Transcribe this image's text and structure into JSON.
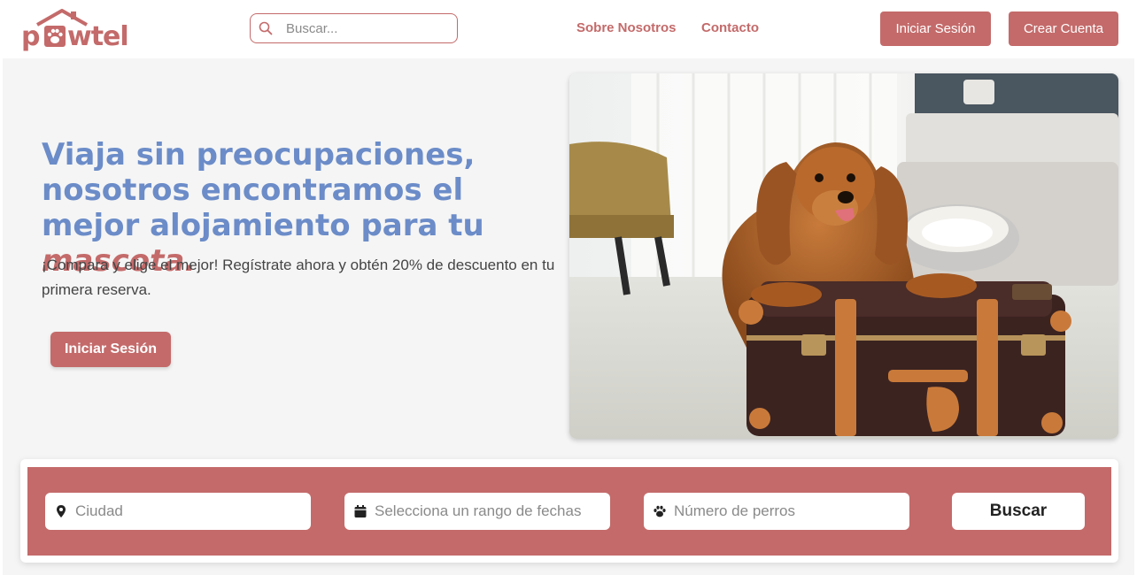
{
  "brand": {
    "logo_text": "pawtel",
    "primary_color": "#c46a6a",
    "accent_color": "#6b8cc8"
  },
  "header": {
    "search": {
      "placeholder": "Buscar...",
      "icon": "search-icon"
    },
    "nav": {
      "about": "Sobre Nosotros",
      "contact": "Contacto"
    },
    "login_button": "Iniciar Sesión",
    "signup_button": "Crear Cuenta"
  },
  "hero": {
    "title_main": "Viaja sin preocupaciones, nosotros encontramos el mejor alojamiento para tu ",
    "title_emphasis": "mascota.",
    "subtitle": "¡Compara y elige el mejor! Regístrate ahora y obtén 20% de descuento en tu primera reserva.",
    "login_button": "Iniciar Sesión",
    "image_subject": "dog-on-suitcase"
  },
  "search_bar": {
    "city": {
      "placeholder": "Ciudad",
      "icon": "map-pin-icon"
    },
    "dates": {
      "placeholder": "Selecciona un rango de fechas",
      "icon": "calendar-icon"
    },
    "dogs": {
      "placeholder": "Número de perros",
      "icon": "paw-icon"
    },
    "button": "Buscar"
  }
}
